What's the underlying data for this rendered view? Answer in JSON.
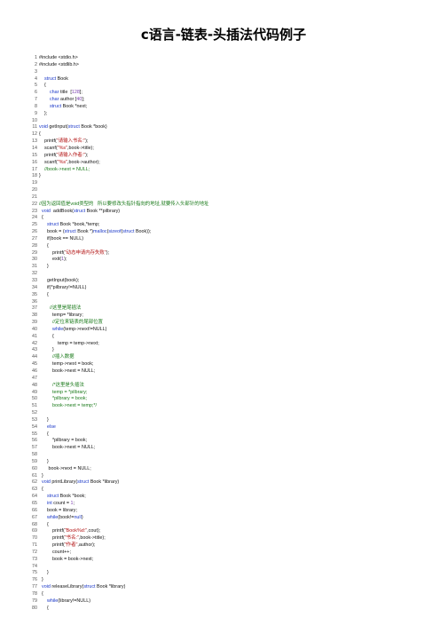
{
  "title": "c语言-链表-头插法代码例子",
  "code_lines": [
    [
      {
        "t": "#include <stdio.h>"
      }
    ],
    [
      {
        "t": "#include <stdlib.h>"
      }
    ],
    [
      {
        "t": ""
      }
    ],
    [
      {
        "t": "    "
      },
      {
        "t": "struct",
        "c": "kw"
      },
      {
        "t": " Book"
      }
    ],
    [
      {
        "t": "    {"
      }
    ],
    [
      {
        "t": "        "
      },
      {
        "t": "char",
        "c": "kw"
      },
      {
        "t": " title  ["
      },
      {
        "t": "128",
        "c": "nm"
      },
      {
        "t": "];"
      }
    ],
    [
      {
        "t": "        "
      },
      {
        "t": "char",
        "c": "kw"
      },
      {
        "t": " author ["
      },
      {
        "t": "40",
        "c": "nm"
      },
      {
        "t": "];"
      }
    ],
    [
      {
        "t": "        "
      },
      {
        "t": "struct",
        "c": "kw"
      },
      {
        "t": " Book *next;"
      }
    ],
    [
      {
        "t": "    };"
      }
    ],
    [
      {
        "t": ""
      }
    ],
    [
      {
        "t": "void",
        "c": "kw"
      },
      {
        "t": " getInput("
      },
      {
        "t": "struct",
        "c": "kw"
      },
      {
        "t": " Book *book)"
      }
    ],
    [
      {
        "t": "{"
      }
    ],
    [
      {
        "t": "    printf("
      },
      {
        "t": "\"请输入书名:\"",
        "c": "str"
      },
      {
        "t": ");"
      }
    ],
    [
      {
        "t": "    scanf("
      },
      {
        "t": "\"%s\"",
        "c": "str"
      },
      {
        "t": ",book->title);"
      }
    ],
    [
      {
        "t": "    printf("
      },
      {
        "t": "\"请输入作者:\"",
        "c": "str"
      },
      {
        "t": ");"
      }
    ],
    [
      {
        "t": "    scanf("
      },
      {
        "t": "\"%s\"",
        "c": "str"
      },
      {
        "t": ",book->author);"
      }
    ],
    [
      {
        "t": "    "
      },
      {
        "t": "//book->next = NULL;",
        "c": "cm"
      }
    ],
    [
      {
        "t": "}"
      }
    ],
    [
      {
        "t": ""
      }
    ],
    [
      {
        "t": ""
      }
    ],
    [
      {
        "t": ""
      }
    ],
    [
      {
        "t": "//因为返回值是void类型的   所以要修改头指针指向的地址,就要传入头部针的地址",
        "c": "cm"
      }
    ],
    [
      {
        "t": "  "
      },
      {
        "t": "void",
        "c": "kw"
      },
      {
        "t": "  addBook("
      },
      {
        "t": "struct",
        "c": "kw"
      },
      {
        "t": " Book **pilbrary)"
      }
    ],
    [
      {
        "t": "  {"
      }
    ],
    [
      {
        "t": "      "
      },
      {
        "t": "struct",
        "c": "kw"
      },
      {
        "t": " Book *book,*temp;"
      }
    ],
    [
      {
        "t": "      book = ("
      },
      {
        "t": "struct",
        "c": "kw"
      },
      {
        "t": " Book *)"
      },
      {
        "t": "malloc",
        "c": "kw"
      },
      {
        "t": "("
      },
      {
        "t": "sizeof",
        "c": "kw"
      },
      {
        "t": "("
      },
      {
        "t": "struct",
        "c": "kw"
      },
      {
        "t": " Book));"
      }
    ],
    [
      {
        "t": "      if(book == NULL)"
      }
    ],
    [
      {
        "t": "      {"
      }
    ],
    [
      {
        "t": "          printf("
      },
      {
        "t": "\"动态申请内存失败\"",
        "c": "str"
      },
      {
        "t": ");"
      }
    ],
    [
      {
        "t": "          exit("
      },
      {
        "t": "1",
        "c": "nm"
      },
      {
        "t": ");"
      }
    ],
    [
      {
        "t": "      }"
      }
    ],
    [
      {
        "t": ""
      }
    ],
    [
      {
        "t": "      getInput(book);"
      }
    ],
    [
      {
        "t": "      if(*pilbrary!=NULL)"
      }
    ],
    [
      {
        "t": "      {"
      }
    ],
    [
      {
        "t": ""
      }
    ],
    [
      {
        "t": "        "
      },
      {
        "t": "//这里是尾插法",
        "c": "cm"
      }
    ],
    [
      {
        "t": "          temp= *library;"
      }
    ],
    [
      {
        "t": "          "
      },
      {
        "t": "//定位来链表的尾部位置",
        "c": "cm"
      }
    ],
    [
      {
        "t": "          "
      },
      {
        "t": "while",
        "c": "kw"
      },
      {
        "t": "(temp->next!=NULL)"
      }
    ],
    [
      {
        "t": "          {"
      }
    ],
    [
      {
        "t": "              temp = temp->next;"
      }
    ],
    [
      {
        "t": "          }"
      }
    ],
    [
      {
        "t": "          "
      },
      {
        "t": "//插入数据",
        "c": "cm"
      }
    ],
    [
      {
        "t": "          temp->next = book;"
      }
    ],
    [
      {
        "t": "          book->next = NULL;"
      }
    ],
    [
      {
        "t": ""
      }
    ],
    [
      {
        "t": "          "
      },
      {
        "t": "/*这里是头插法",
        "c": "cm"
      }
    ],
    [
      {
        "t": "          "
      },
      {
        "t": "temp = *pilbrary;",
        "c": "cm"
      }
    ],
    [
      {
        "t": "          "
      },
      {
        "t": "*pilbrary = book;",
        "c": "cm"
      }
    ],
    [
      {
        "t": "          "
      },
      {
        "t": "book->next = temp;*/",
        "c": "cm"
      }
    ],
    [
      {
        "t": ""
      }
    ],
    [
      {
        "t": "      }"
      }
    ],
    [
      {
        "t": "      "
      },
      {
        "t": "else",
        "c": "kw"
      }
    ],
    [
      {
        "t": "      {"
      }
    ],
    [
      {
        "t": "          *pilbrary = book;"
      }
    ],
    [
      {
        "t": "          book->next = NULL;"
      }
    ],
    [
      {
        "t": ""
      }
    ],
    [
      {
        "t": "      }"
      }
    ],
    [
      {
        "t": "       book->next = NULL;"
      }
    ],
    [
      {
        "t": "  }"
      }
    ],
    [
      {
        "t": "  "
      },
      {
        "t": "void",
        "c": "kw"
      },
      {
        "t": " printLibrary("
      },
      {
        "t": "struct",
        "c": "kw"
      },
      {
        "t": " Book *library)"
      }
    ],
    [
      {
        "t": "  {"
      }
    ],
    [
      {
        "t": "      "
      },
      {
        "t": "struct",
        "c": "kw"
      },
      {
        "t": " Book *book;"
      }
    ],
    [
      {
        "t": "      "
      },
      {
        "t": "int",
        "c": "kw"
      },
      {
        "t": " count = "
      },
      {
        "t": "1",
        "c": "nm"
      },
      {
        "t": ";"
      }
    ],
    [
      {
        "t": "      book = library;"
      }
    ],
    [
      {
        "t": "      "
      },
      {
        "t": "while",
        "c": "kw"
      },
      {
        "t": "(book!="
      },
      {
        "t": "null",
        "c": "kw"
      },
      {
        "t": ")"
      }
    ],
    [
      {
        "t": "      {"
      }
    ],
    [
      {
        "t": "          printf("
      },
      {
        "t": "\"Book%d:\"",
        "c": "str"
      },
      {
        "t": ",cout);"
      }
    ],
    [
      {
        "t": "          printf("
      },
      {
        "t": "\"书名:\"",
        "c": "str"
      },
      {
        "t": ",book->title);"
      }
    ],
    [
      {
        "t": "          printf("
      },
      {
        "t": "\"作者\"",
        "c": "str"
      },
      {
        "t": ",author);"
      }
    ],
    [
      {
        "t": "          count++;"
      }
    ],
    [
      {
        "t": "          book = book->next;"
      }
    ],
    [
      {
        "t": ""
      }
    ],
    [
      {
        "t": "      }"
      }
    ],
    [
      {
        "t": "  }"
      }
    ],
    [
      {
        "t": "  "
      },
      {
        "t": "void",
        "c": "kw"
      },
      {
        "t": " releaseLibrary("
      },
      {
        "t": "struct",
        "c": "kw"
      },
      {
        "t": " Book *library)"
      }
    ],
    [
      {
        "t": "  {"
      }
    ],
    [
      {
        "t": "      "
      },
      {
        "t": "while",
        "c": "kw"
      },
      {
        "t": "(library!=NULL)"
      }
    ],
    [
      {
        "t": "      {"
      }
    ]
  ]
}
